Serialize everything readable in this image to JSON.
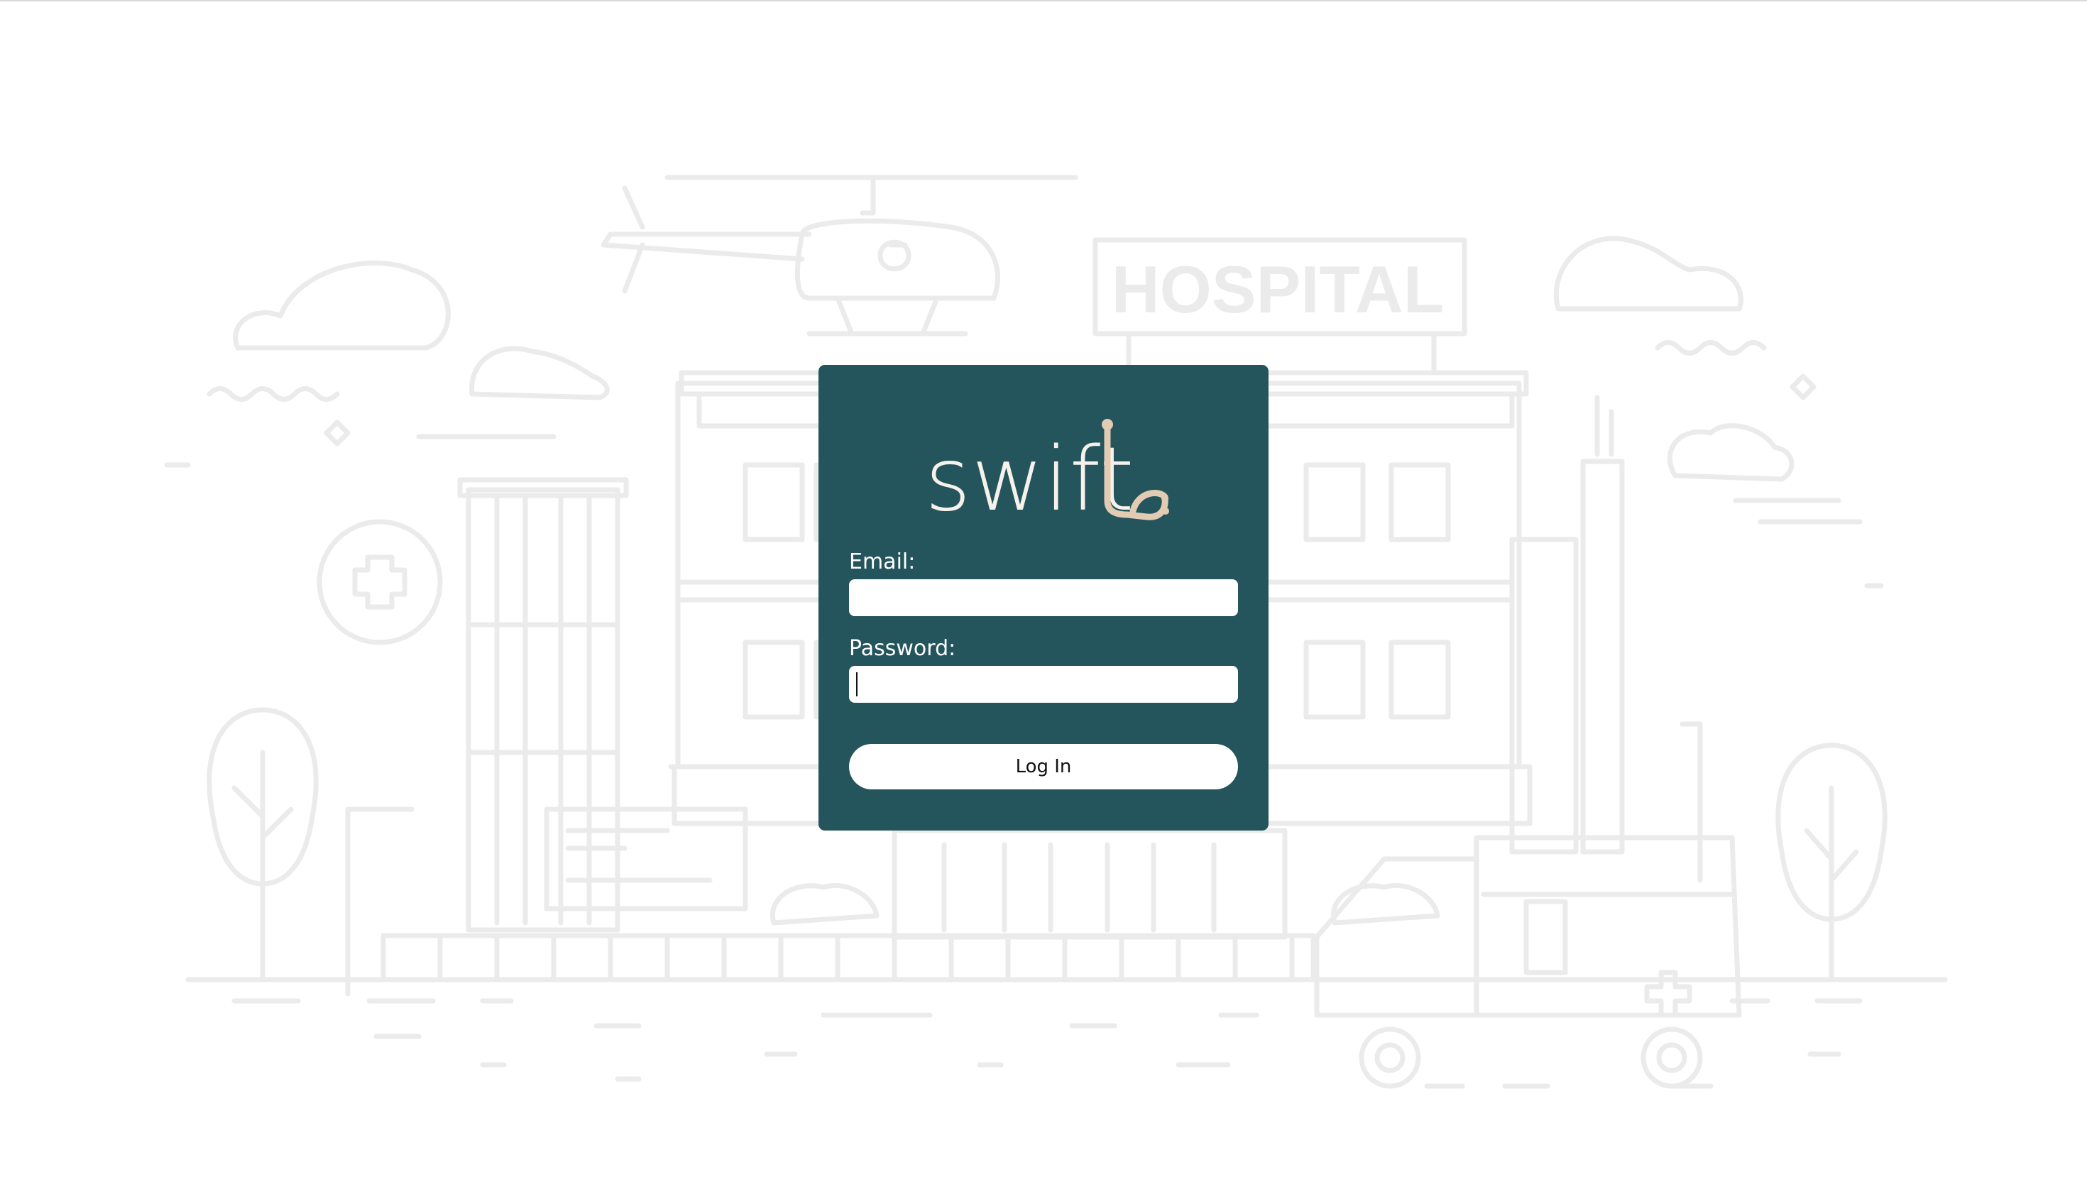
{
  "brand": {
    "logo_text": "swift",
    "accent_color": "#e2cbb3",
    "card_color": "#24555c"
  },
  "background": {
    "illustration": "hospital-scene",
    "sign_text": "HOSPITAL"
  },
  "form": {
    "email_label": "Email:",
    "email_value": "",
    "password_label": "Password:",
    "password_value": "",
    "submit_label": "Log In"
  }
}
